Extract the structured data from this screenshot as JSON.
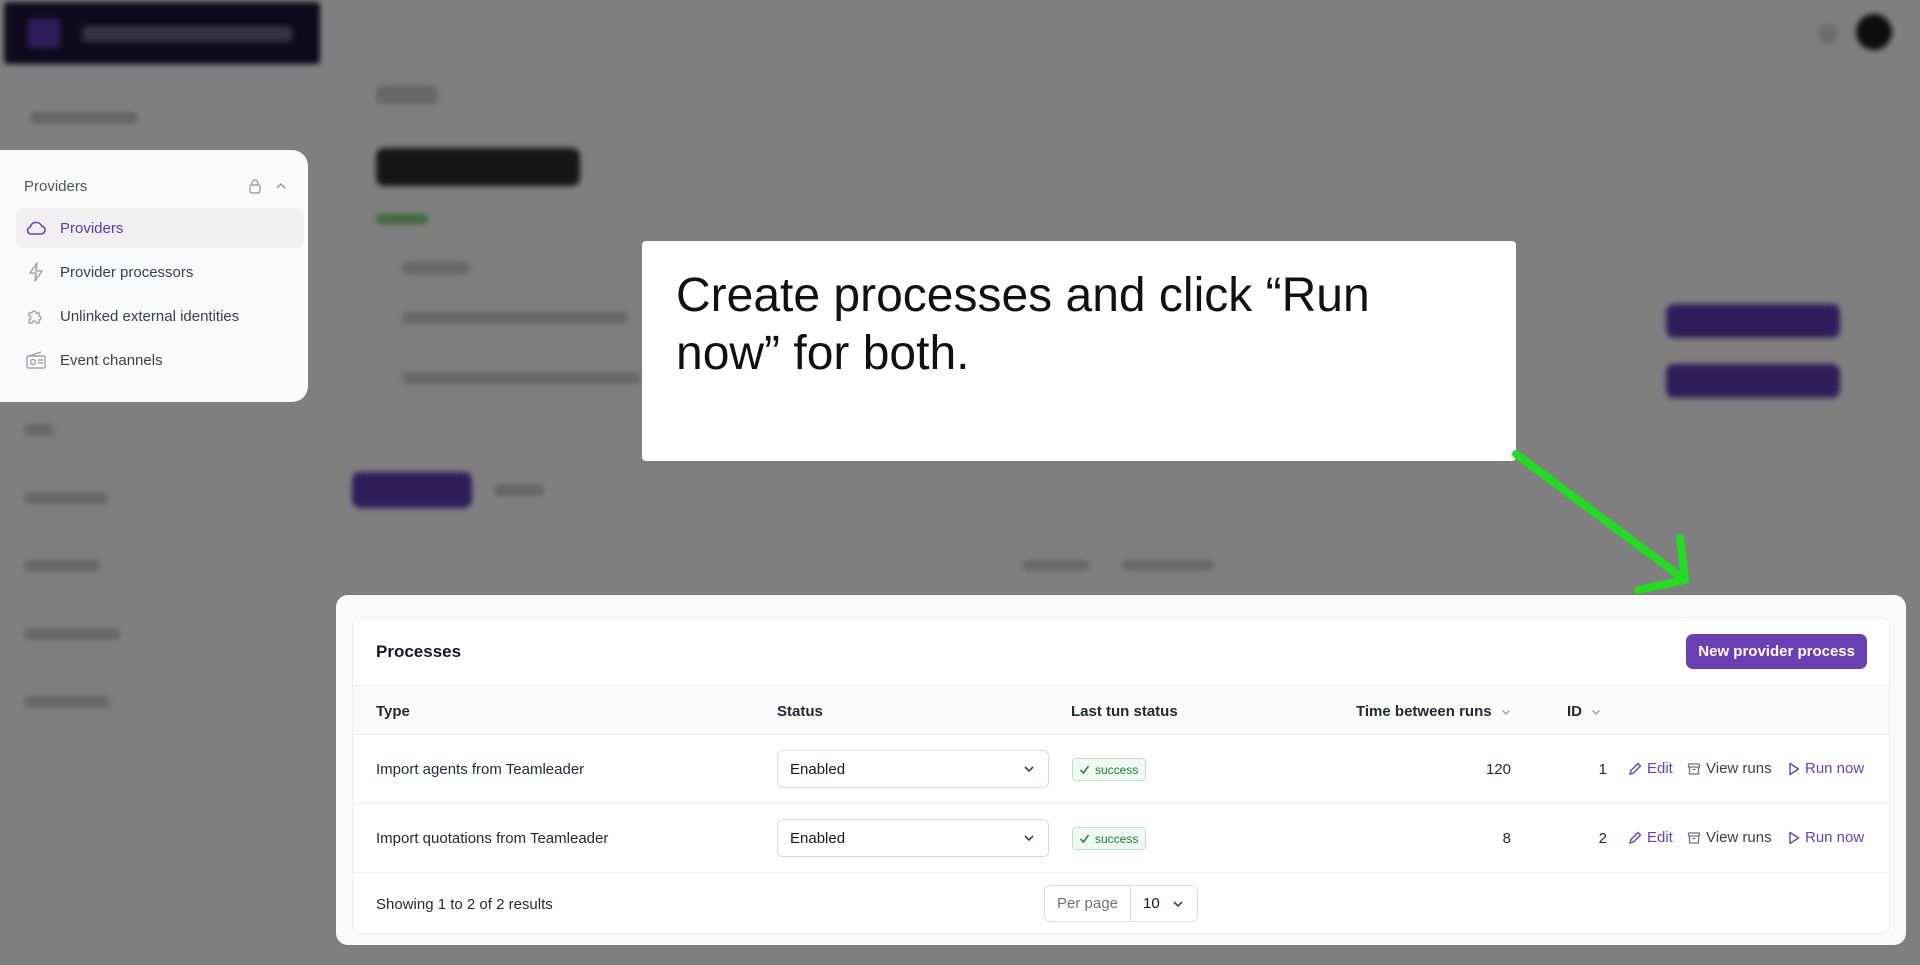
{
  "sidebar": {
    "section_label": "Providers",
    "items": [
      {
        "label": "Providers",
        "icon": "cloud-icon"
      },
      {
        "label": "Provider processors",
        "icon": "bolt-icon"
      },
      {
        "label": "Unlinked external identities",
        "icon": "puzzle-icon"
      },
      {
        "label": "Event channels",
        "icon": "radio-icon"
      }
    ]
  },
  "tooltip": {
    "text": "Create processes and click “Run now” for both."
  },
  "processes": {
    "title": "Processes",
    "new_button": "New provider process",
    "columns": {
      "type": "Type",
      "status": "Status",
      "last_run": "Last tun status",
      "time_between": "Time between runs",
      "id": "ID"
    },
    "rows": [
      {
        "type": "Import agents from Teamleader",
        "status": "Enabled",
        "last_status": "success",
        "time": "120",
        "id": "1"
      },
      {
        "type": "Import quotations from Teamleader",
        "status": "Enabled",
        "last_status": "success",
        "time": "8",
        "id": "2"
      }
    ],
    "actions": {
      "edit": "Edit",
      "view_runs": "View runs",
      "run_now": "Run now"
    },
    "footer": {
      "showing": "Showing 1 to 2 of 2 results",
      "per_page_label": "Per page",
      "per_page_value": "10"
    }
  },
  "colors": {
    "accent": "#6a3fb4",
    "success": "#1f7a3a",
    "arrow": "#22dd22"
  }
}
